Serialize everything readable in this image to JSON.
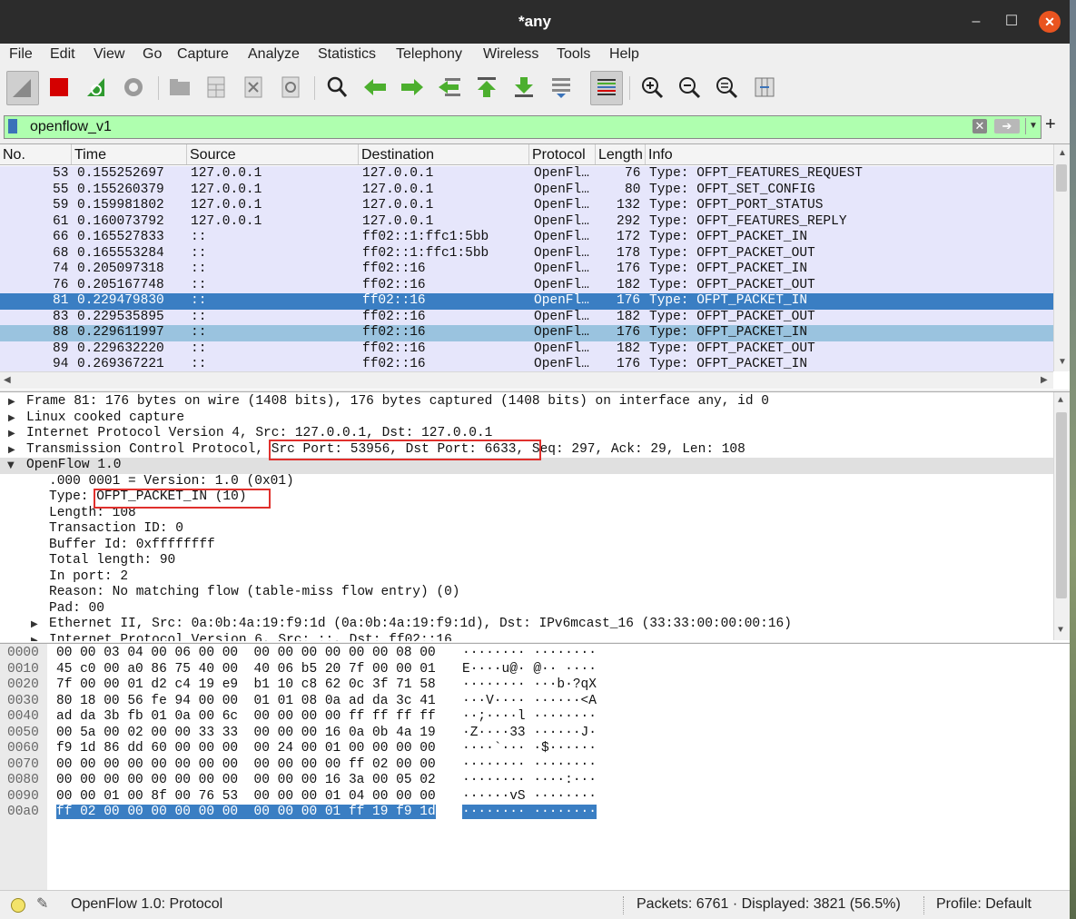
{
  "window": {
    "title": "*any"
  },
  "menu": [
    "File",
    "Edit",
    "View",
    "Go",
    "Capture",
    "Analyze",
    "Statistics",
    "Telephony",
    "Wireless",
    "Tools",
    "Help"
  ],
  "filter": {
    "value": "openflow_v1"
  },
  "columns": [
    "No.",
    "Time",
    "Source",
    "Destination",
    "Protocol",
    "Length",
    "Info"
  ],
  "packets": [
    {
      "no": "53",
      "time": "0.155252697",
      "src": "127.0.0.1",
      "dst": "127.0.0.1",
      "proto": "OpenFl…",
      "len": "76",
      "info": "Type: OFPT_FEATURES_REQUEST"
    },
    {
      "no": "55",
      "time": "0.155260379",
      "src": "127.0.0.1",
      "dst": "127.0.0.1",
      "proto": "OpenFl…",
      "len": "80",
      "info": "Type: OFPT_SET_CONFIG"
    },
    {
      "no": "59",
      "time": "0.159981802",
      "src": "127.0.0.1",
      "dst": "127.0.0.1",
      "proto": "OpenFl…",
      "len": "132",
      "info": "Type: OFPT_PORT_STATUS"
    },
    {
      "no": "61",
      "time": "0.160073792",
      "src": "127.0.0.1",
      "dst": "127.0.0.1",
      "proto": "OpenFl…",
      "len": "292",
      "info": "Type: OFPT_FEATURES_REPLY"
    },
    {
      "no": "66",
      "time": "0.165527833",
      "src": "::",
      "dst": "ff02::1:ffc1:5bb",
      "proto": "OpenFl…",
      "len": "172",
      "info": "Type: OFPT_PACKET_IN"
    },
    {
      "no": "68",
      "time": "0.165553284",
      "src": "::",
      "dst": "ff02::1:ffc1:5bb",
      "proto": "OpenFl…",
      "len": "178",
      "info": "Type: OFPT_PACKET_OUT"
    },
    {
      "no": "74",
      "time": "0.205097318",
      "src": "::",
      "dst": "ff02::16",
      "proto": "OpenFl…",
      "len": "176",
      "info": "Type: OFPT_PACKET_IN"
    },
    {
      "no": "76",
      "time": "0.205167748",
      "src": "::",
      "dst": "ff02::16",
      "proto": "OpenFl…",
      "len": "182",
      "info": "Type: OFPT_PACKET_OUT"
    },
    {
      "no": "81",
      "time": "0.229479830",
      "src": "::",
      "dst": "ff02::16",
      "proto": "OpenFl…",
      "len": "176",
      "info": "Type: OFPT_PACKET_IN"
    },
    {
      "no": "83",
      "time": "0.229535895",
      "src": "::",
      "dst": "ff02::16",
      "proto": "OpenFl…",
      "len": "182",
      "info": "Type: OFPT_PACKET_OUT"
    },
    {
      "no": "88",
      "time": "0.229611997",
      "src": "::",
      "dst": "ff02::16",
      "proto": "OpenFl…",
      "len": "176",
      "info": "Type: OFPT_PACKET_IN"
    },
    {
      "no": "89",
      "time": "0.229632220",
      "src": "::",
      "dst": "ff02::16",
      "proto": "OpenFl…",
      "len": "182",
      "info": "Type: OFPT_PACKET_OUT"
    },
    {
      "no": "94",
      "time": "0.269367221",
      "src": "::",
      "dst": "ff02::16",
      "proto": "OpenFl…",
      "len": "176",
      "info": "Type: OFPT_PACKET_IN"
    }
  ],
  "selected_packet": "81",
  "details": [
    {
      "text": "Frame 81: 176 bytes on wire (1408 bits), 176 bytes captured (1408 bits) on interface any, id 0",
      "level": 0,
      "toggle": "collapsed"
    },
    {
      "text": "Linux cooked capture",
      "level": 0,
      "toggle": "collapsed"
    },
    {
      "text": "Internet Protocol Version 4, Src: 127.0.0.1, Dst: 127.0.0.1",
      "level": 0,
      "toggle": "collapsed"
    },
    {
      "text": "Transmission Control Protocol, Src Port: 53956, Dst Port: 6633, Seq: 297, Ack: 29, Len: 108",
      "level": 0,
      "toggle": "collapsed"
    },
    {
      "text": "OpenFlow 1.0",
      "level": 0,
      "toggle": "expanded"
    },
    {
      "text": ".000 0001 = Version: 1.0 (0x01)",
      "level": 1,
      "toggle": "none"
    },
    {
      "text": "Type: OFPT_PACKET_IN (10)",
      "level": 1,
      "toggle": "none"
    },
    {
      "text": "Length: 108",
      "level": 1,
      "toggle": "none"
    },
    {
      "text": "Transaction ID: 0",
      "level": 1,
      "toggle": "none"
    },
    {
      "text": "Buffer Id: 0xffffffff",
      "level": 1,
      "toggle": "none"
    },
    {
      "text": "Total length: 90",
      "level": 1,
      "toggle": "none"
    },
    {
      "text": "In port: 2",
      "level": 1,
      "toggle": "none"
    },
    {
      "text": "Reason: No matching flow (table-miss flow entry) (0)",
      "level": 1,
      "toggle": "none"
    },
    {
      "text": "Pad: 00",
      "level": 1,
      "toggle": "none"
    },
    {
      "text": "Ethernet II, Src: 0a:0b:4a:19:f9:1d (0a:0b:4a:19:f9:1d), Dst: IPv6mcast_16 (33:33:00:00:00:16)",
      "level": 1,
      "toggle": "collapsed"
    },
    {
      "text": "Internet Protocol Version 6, Src: ::, Dst: ff02::16",
      "level": 1,
      "toggle": "collapsed"
    }
  ],
  "bytes": [
    {
      "off": "0000",
      "hex": "00 00 03 04 00 06 00 00  00 00 00 00 00 00 08 00",
      "ascii": "········ ········"
    },
    {
      "off": "0010",
      "hex": "45 c0 00 a0 86 75 40 00  40 06 b5 20 7f 00 00 01",
      "ascii": "E····u@· @·· ····"
    },
    {
      "off": "0020",
      "hex": "7f 00 00 01 d2 c4 19 e9  b1 10 c8 62 0c 3f 71 58",
      "ascii": "········ ···b·?qX"
    },
    {
      "off": "0030",
      "hex": "80 18 00 56 fe 94 00 00  01 01 08 0a ad da 3c 41",
      "ascii": "···V···· ······<A"
    },
    {
      "off": "0040",
      "hex": "ad da 3b fb 01 0a 00 6c  00 00 00 00 ff ff ff ff",
      "ascii": "··;····l ········"
    },
    {
      "off": "0050",
      "hex": "00 5a 00 02 00 00 33 33  00 00 00 16 0a 0b 4a 19",
      "ascii": "·Z····33 ······J·"
    },
    {
      "off": "0060",
      "hex": "f9 1d 86 dd 60 00 00 00  00 24 00 01 00 00 00 00",
      "ascii": "····`··· ·$······"
    },
    {
      "off": "0070",
      "hex": "00 00 00 00 00 00 00 00  00 00 00 00 ff 02 00 00",
      "ascii": "········ ········"
    },
    {
      "off": "0080",
      "hex": "00 00 00 00 00 00 00 00  00 00 00 16 3a 00 05 02",
      "ascii": "········ ····:···"
    },
    {
      "off": "0090",
      "hex": "00 00 01 00 8f 00 76 53  00 00 00 01 04 00 00 00",
      "ascii": "······vS ········"
    },
    {
      "off": "00a0",
      "hex": "ff 02 00 00 00 00 00 00  00 00 00 01 ff 19 f9 1d",
      "ascii": "········ ········"
    }
  ],
  "status": {
    "field": "OpenFlow 1.0: Protocol",
    "packets": "Packets: 6761 · Displayed: 3821 (56.5%)",
    "profile": "Profile: Default"
  },
  "colors": {
    "selected": "#3a7ec3",
    "related": "#9ac3df",
    "row": "#e6e6fb",
    "filter_ok": "#afffaf",
    "annotation": "#e0302c"
  }
}
